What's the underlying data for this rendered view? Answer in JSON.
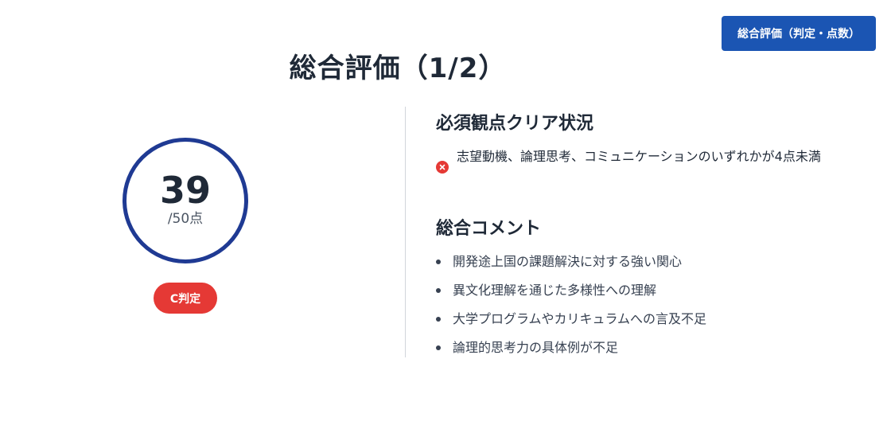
{
  "header": {
    "evaluation_button_label": "総合評価（判定・点数）",
    "title": "総合評価（1/2）"
  },
  "score": {
    "value": "39",
    "max_label": "/50点",
    "grade_label": "C判定"
  },
  "required_section": {
    "heading": "必須観点クリア状況",
    "items": [
      {
        "status_icon": "x-circle-icon",
        "text": "志望動機、論理思考、コミュニケーションのいずれかが4点未満"
      }
    ]
  },
  "comment_section": {
    "heading": "総合コメント",
    "items": [
      "開発途上国の課題解決に対する強い関心",
      "異文化理解を通じた多様性への理解",
      "大学プログラムやカリキュラムへの言及不足",
      "論理的思考力の具体例が不足"
    ]
  },
  "colors": {
    "primary": "#1b55b3",
    "ring": "#1f3a93",
    "danger": "#e53935",
    "text": "#1f2937"
  }
}
